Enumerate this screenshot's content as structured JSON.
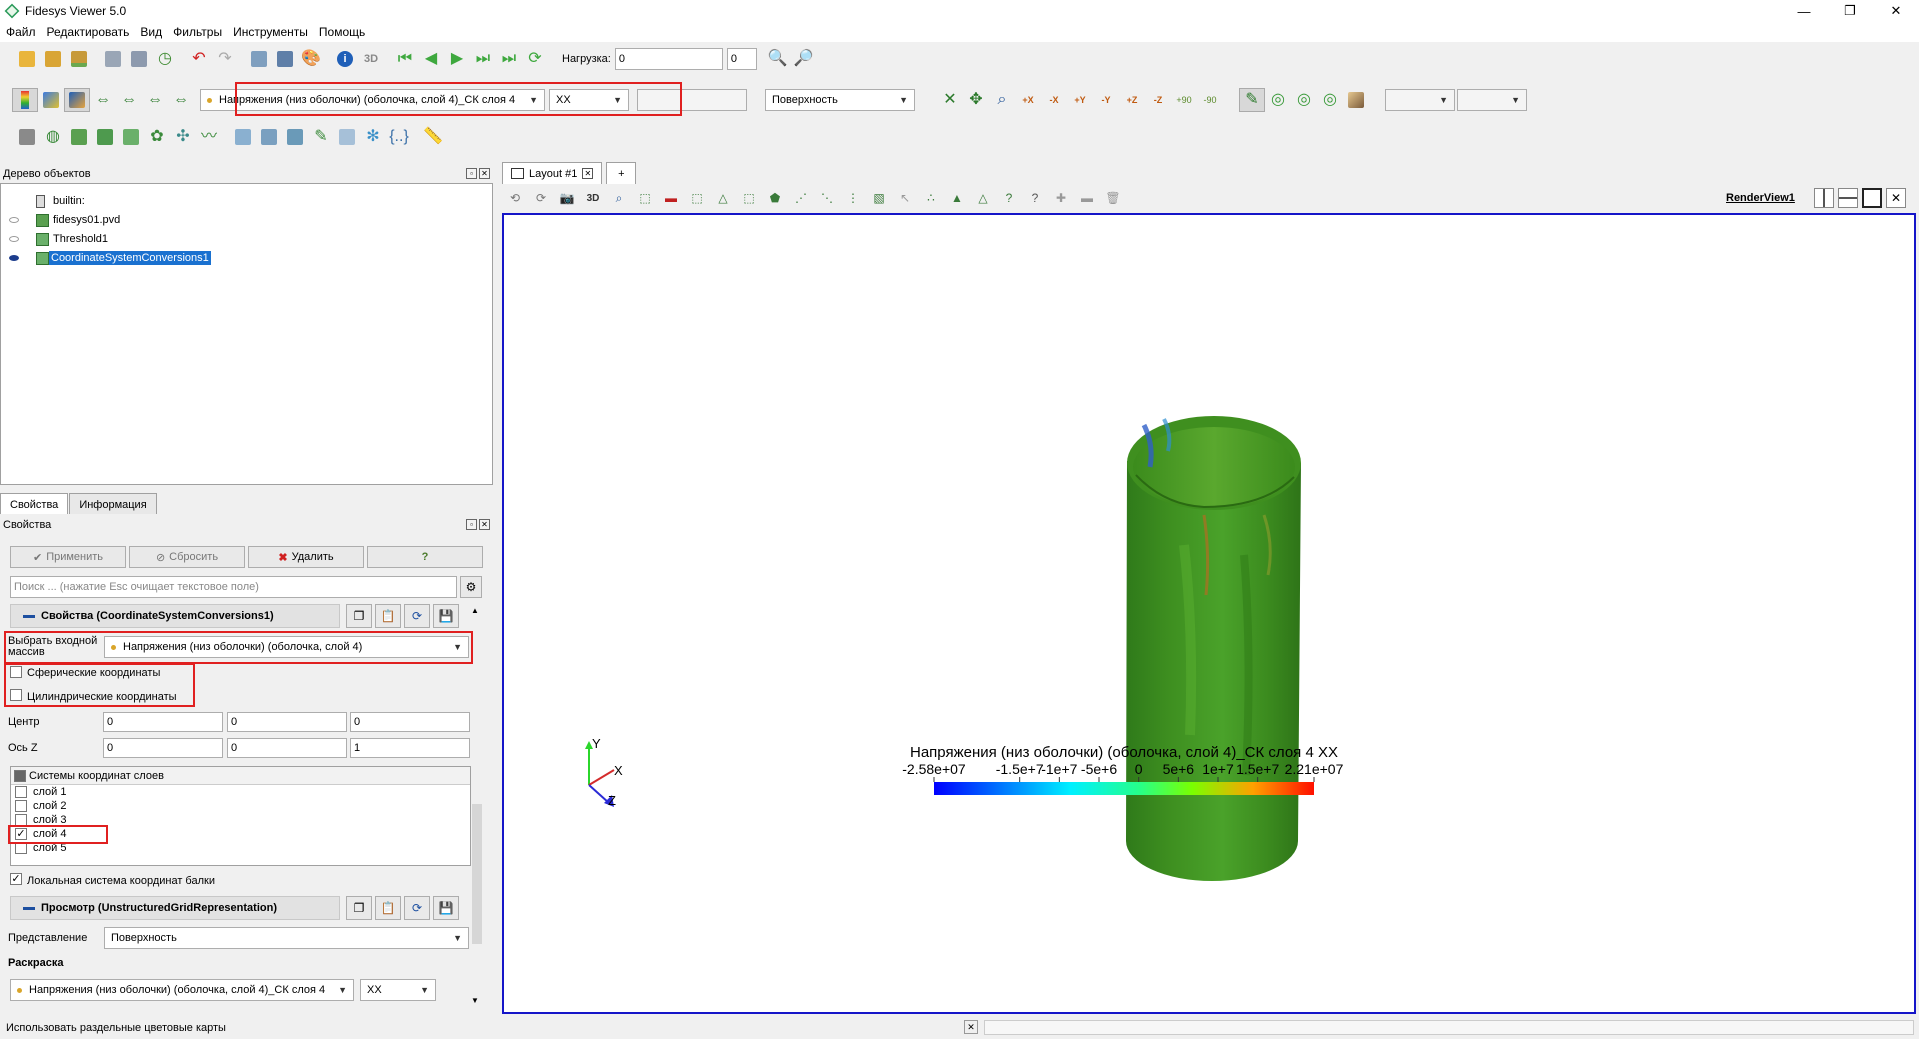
{
  "window": {
    "title": "Fidesys Viewer 5.0",
    "controls": [
      "—",
      "❐",
      "✕"
    ]
  },
  "menu": [
    "Файл",
    "Редактировать",
    "Вид",
    "Фильтры",
    "Инструменты",
    "Помощь"
  ],
  "toolbar1": {
    "load_label": "Нагрузка:",
    "load_value": "0",
    "spin_value": "0"
  },
  "toolbar2": {
    "array_selected": "Напряжения (низ оболочки) (оболочка, слой 4)_СК слоя 4",
    "component_selected": "XX",
    "representation_selected": "Поверхность",
    "camera_labels": [
      "+X",
      "-X",
      "+Y",
      "-Y",
      "+Z",
      "-Z",
      "+90",
      "-90"
    ]
  },
  "tree": {
    "title": "Дерево объектов",
    "items": [
      {
        "label": "builtin:"
      },
      {
        "label": "fidesys01.pvd"
      },
      {
        "label": "Threshold1"
      },
      {
        "label": "CoordinateSystemConversions1"
      }
    ]
  },
  "panel_tabs": [
    "Свойства",
    "Информация"
  ],
  "properties": {
    "title": "Свойства",
    "apply": "Применить",
    "reset": "Сбросить",
    "delete": "Удалить",
    "help": "?",
    "search_placeholder": "Поиск ... (нажатие Esc очищает текстовое поле)",
    "section1": "Свойства (CoordinateSystemConversions1)",
    "input_array_label_1": "Выбрать входной",
    "input_array_label_2": "массив",
    "input_array_value": "Напряжения (низ оболочки) (оболочка, слой 4)",
    "spherical": "Сферические координаты",
    "cylindrical": "Цилиндрические координаты",
    "center_label": "Центр",
    "center": [
      "0",
      "0",
      "0"
    ],
    "zaxis_label": "Ось Z",
    "zaxis": [
      "0",
      "0",
      "1"
    ],
    "layers_title": "Системы координат слоев",
    "layers": [
      {
        "label": "слой 1",
        "checked": false
      },
      {
        "label": "слой 2",
        "checked": false
      },
      {
        "label": "слой 3",
        "checked": false
      },
      {
        "label": "слой 4",
        "checked": true
      },
      {
        "label": "слой 5",
        "checked": false
      }
    ],
    "beam_local": "Локальная система координат балки",
    "section2": "Просмотр (UnstructuredGridRepresentation)",
    "representation_label": "Представление",
    "representation_value": "Поверхность",
    "coloring_label": "Раскраска",
    "coloring_array": "Напряжения (низ оболочки) (оболочка, слой 4)_СК слоя 4",
    "coloring_component": "XX"
  },
  "view": {
    "layout_tab": "Layout #1",
    "add_tab": "+",
    "render_view_name": "RenderView1",
    "toolbar_3d": "3D",
    "axes": {
      "x": "X",
      "y": "Y",
      "z": "Z"
    },
    "colorbar": {
      "title": "Напряжения (низ оболочки) (оболочка, слой 4)_СК слоя 4 XX",
      "ticks": [
        "-2.58e+07",
        "-1.5e+7",
        "-1e+7",
        "-5e+6",
        "0",
        "5e+6",
        "1e+7",
        "1.5e+7",
        "2.21e+07"
      ],
      "tick_values": [
        -25800000,
        -15000000,
        -10000000,
        -5000000,
        0,
        5000000,
        10000000,
        15000000,
        22100000
      ],
      "range": [
        -25800000,
        22100000
      ]
    }
  },
  "status": {
    "text": "Использовать раздельные цветовые карты"
  },
  "colors": {
    "highlight_red": "#e02020",
    "selection_blue": "#1a71d0",
    "view_border": "#1515c8",
    "mesh_green": "#3f8f22"
  }
}
